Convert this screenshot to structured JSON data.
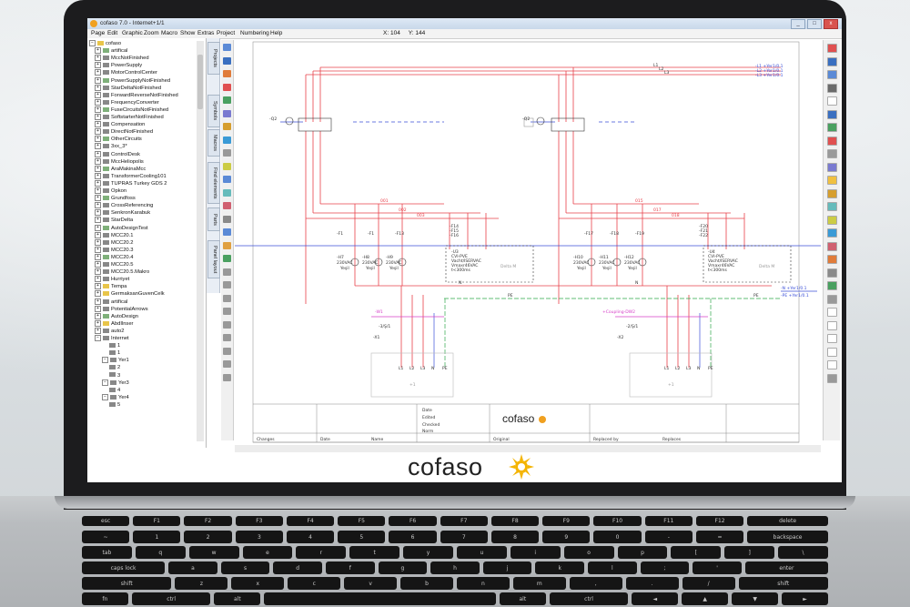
{
  "window": {
    "title": "cofaso 7.0 - Internet+1/1",
    "buttons": {
      "minimize": "_",
      "maximize": "□",
      "close": "x"
    }
  },
  "menu": [
    "Page",
    "Edit",
    "Graphic",
    "Zoom",
    "Macro",
    "Show",
    "Extras",
    "Project",
    "Numbering",
    "Help"
  ],
  "coords": {
    "x_label": "X:",
    "x": "104",
    "y_label": "Y:",
    "y": "144"
  },
  "tree": {
    "root": "cofaso",
    "items": [
      "artifical",
      "MccNotFinished",
      "PowerSupply",
      "MotorControlCenter",
      "PowerSupplyNotFinished",
      "StarDeltaNotFinished",
      "ForwardReverseNotFinished",
      "FrequencyConverter",
      "FuseCircuitsNotFinished",
      "SoftstarterNotFinished",
      "Compensation",
      "DirectNotFinished",
      "OtherCircuits",
      "3xx_3*",
      "ControlDesk",
      "MccHeliopolis",
      "AraMakinaMcc",
      "TransformerCooling101",
      "TUPRAS Turkey GDS 2",
      "Opkon",
      "Grundfoss",
      "CrossReferencing",
      "SenkronKarabuk",
      "StarDelta",
      "AutoDesignTest",
      "MCC20.1",
      "MCC20.2",
      "MCC20.3",
      "MCC20.4",
      "MCC20.5",
      "MCC20.5.Makro",
      "Hurriyet",
      "Tempa",
      "GermaksanGuvenCelk",
      "artifical",
      "PotentialArrows",
      "AutoDesign",
      "AbdIlnser",
      "auto2",
      "Internet"
    ],
    "internet_children": [
      "1",
      "1",
      "Yer1",
      "2",
      "3",
      "Yer3",
      "4",
      "Yer4",
      "5"
    ]
  },
  "side_tabs": [
    "Projects",
    "Symbols",
    "Macros",
    "Find elements",
    "Parts",
    "Panel layout"
  ],
  "schematic": {
    "bus_labels": [
      "L1",
      "L2",
      "L3"
    ],
    "bus_out": [
      "-L1 +Yer1/0.1",
      "-L2 +Yer1/0.1",
      "-L3 +Yer1/0.1"
    ],
    "breakers": [
      "-Q2",
      "-Q2"
    ],
    "wire_labels_left": [
      "001",
      "002",
      "003",
      "004"
    ],
    "wire_labels_right": [
      "015",
      "016",
      "017",
      "018"
    ],
    "fuses_left": [
      "-F1",
      "-F1",
      "-F13",
      "-F14",
      "-F15",
      "-F16"
    ],
    "fuses_right": [
      "-F17",
      "-F18",
      "-F19",
      "-F20",
      "-F21",
      "-F22"
    ],
    "lamps_left": [
      "-H7",
      "-H8",
      "-H9"
    ],
    "lamps_right": [
      "-H10",
      "-H11",
      "-H12"
    ],
    "lamp_voltage": "230VAC",
    "lamp_color": "Yeşil",
    "devices": [
      "-U3",
      "-U4"
    ],
    "device_text": [
      "CVI-PVE",
      "Vacht/ISERVAC",
      "Vmaxr46VAC",
      "t<300ms"
    ],
    "panel_label": "Delta M",
    "bus_n": "N",
    "bus_pe": "PE",
    "n_out": "-N +Yer1/0.1",
    "pe_out": "-PE +Yer1/0.1",
    "terminals": [
      "-W1",
      "-X1",
      "+Coupling-DW2",
      "-X2"
    ],
    "terminal_pins": [
      "L1",
      "L2",
      "L3",
      "N",
      "PE"
    ],
    "terminal_labels": [
      "-3/Ş/1",
      "-2/Ş/1"
    ],
    "box_labels": [
      "+1",
      "+1"
    ]
  },
  "title_block": {
    "brand": "cofaso",
    "rows": [
      "Date",
      "Edited",
      "Checked",
      "Norm"
    ],
    "footer": [
      "Changes",
      "Date",
      "Name",
      "Original",
      "Replaced by",
      "Replaces"
    ]
  },
  "logo": {
    "text": "cofaso"
  },
  "keyboard": {
    "row1": [
      "esc",
      "F1",
      "F2",
      "F3",
      "F4",
      "F5",
      "F6",
      "F7",
      "F8",
      "F9",
      "F10",
      "F11",
      "F12",
      "delete"
    ],
    "row2": [
      "~",
      "1",
      "2",
      "3",
      "4",
      "5",
      "6",
      "7",
      "8",
      "9",
      "0",
      "-",
      "=",
      "backspace"
    ],
    "row3": [
      "tab",
      "q",
      "w",
      "e",
      "r",
      "t",
      "y",
      "u",
      "i",
      "o",
      "p",
      "[",
      "]",
      "\\"
    ],
    "row4": [
      "caps lock",
      "a",
      "s",
      "d",
      "f",
      "g",
      "h",
      "j",
      "k",
      "l",
      ";",
      "'",
      "enter"
    ],
    "row5": [
      "shift",
      "z",
      "x",
      "c",
      "v",
      "b",
      "n",
      "m",
      ",",
      ".",
      "/",
      "shift"
    ],
    "row6": [
      "fn",
      "ctrl",
      "alt",
      "",
      "alt",
      "ctrl",
      "◄",
      "▲",
      "▼",
      "►"
    ]
  },
  "colors": {
    "wire_red": "#e8404a",
    "wire_blue": "#3b4fd8",
    "wire_green": "#2fa84a",
    "pink": "#d63fc8",
    "accent_orange": "#f0a020"
  }
}
